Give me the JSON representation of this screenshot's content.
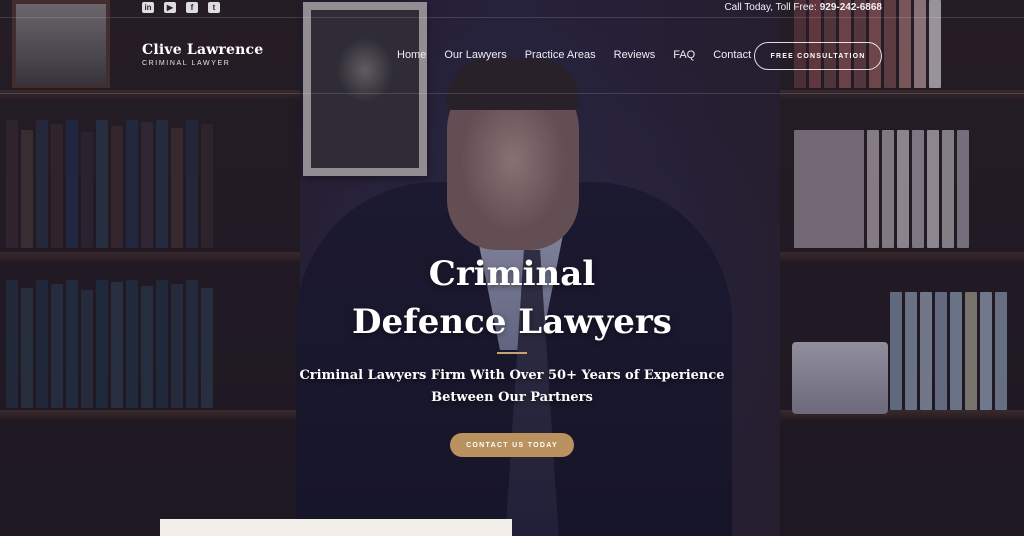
{
  "topbar": {
    "social_icons": [
      "linkedin-icon",
      "youtube-icon",
      "facebook-icon",
      "twitter-icon"
    ],
    "social_glyphs": [
      "in",
      "▶",
      "f",
      "t"
    ],
    "call_label": "Call Today, Toll Free:",
    "phone": "929-242-6868"
  },
  "header": {
    "logo_name": "Clive Lawrence",
    "logo_tagline": "CRIMINAL LAWYER",
    "nav": [
      "Home",
      "Our Lawyers",
      "Practice Areas",
      "Reviews",
      "FAQ",
      "Contact"
    ],
    "consult_button": "FREE CONSULTATION"
  },
  "hero": {
    "title_line1": "Criminal",
    "title_line2": "Defence Lawyers",
    "subtitle_line1": "Criminal Lawyers Firm With Over 50+ Years of Experience",
    "subtitle_line2": "Between Our Partners",
    "cta_label": "CONTACT US TODAY"
  },
  "colors": {
    "accent_gold": "#b9925f",
    "rule_gold": "#c7a46d",
    "overlay": "#1e1a34"
  }
}
